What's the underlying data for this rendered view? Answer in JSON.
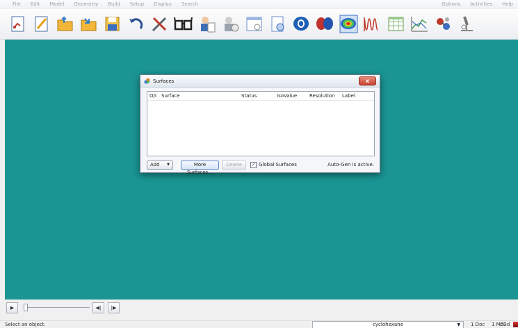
{
  "menubar": {
    "left_items": [
      "File",
      "Edit",
      "Model",
      "Geometry",
      "Build",
      "Setup",
      "Display",
      "Search"
    ],
    "right_items": [
      "Options",
      "Activities",
      "Help"
    ]
  },
  "toolbar": {
    "buttons": [
      {
        "name": "new-document-icon"
      },
      {
        "name": "edit-document-icon"
      },
      {
        "name": "open-folder-icon"
      },
      {
        "name": "folder-arrow-icon"
      },
      {
        "name": "save-folder-icon"
      },
      {
        "name": "undo-icon"
      },
      {
        "name": "tools-icon"
      },
      {
        "name": "glasses-view-icon"
      },
      {
        "name": "person-clipboard-icon"
      },
      {
        "name": "person-settings-icon"
      },
      {
        "name": "window-calendar-icon"
      },
      {
        "name": "document-preview-icon"
      },
      {
        "name": "blue-blob-icon"
      },
      {
        "name": "red-blue-orbital-icon"
      },
      {
        "name": "surface-map-icon"
      },
      {
        "name": "spectrum-peaks-icon"
      },
      {
        "name": "table-grid-icon"
      },
      {
        "name": "line-plot-icon"
      },
      {
        "name": "molecule-icon"
      },
      {
        "name": "microscope-icon"
      }
    ]
  },
  "dialog": {
    "title": "Surfaces",
    "close_label": "x",
    "columns": [
      "O/I",
      "Surface",
      "Status",
      "IsoValue",
      "Resolution",
      "Label"
    ],
    "rows": [],
    "add_label": "Add",
    "add_arrow": "▼",
    "more_surfaces_label": "More Surfaces...",
    "delete_label": "Delete",
    "global_surfaces_checked": true,
    "global_surfaces_check": "✓",
    "global_surfaces_label": "Global Surfaces",
    "autogen_text": "Auto-Gen is active."
  },
  "player": {
    "play_glyph": "▶",
    "step_back_glyph": "◀|",
    "step_forward_glyph": "|▶"
  },
  "statusbar": {
    "message": "Select an object.",
    "molecule_select": "cyclohexane",
    "select_arrow": "▼",
    "doc_count": "1 Doc",
    "mol_count": "1 Mol",
    "symmetry": "D3d"
  },
  "colors": {
    "viewport_bg": "#1a9593",
    "dialog_bg": "#f4f6f9",
    "close_button": "#c6412d"
  }
}
